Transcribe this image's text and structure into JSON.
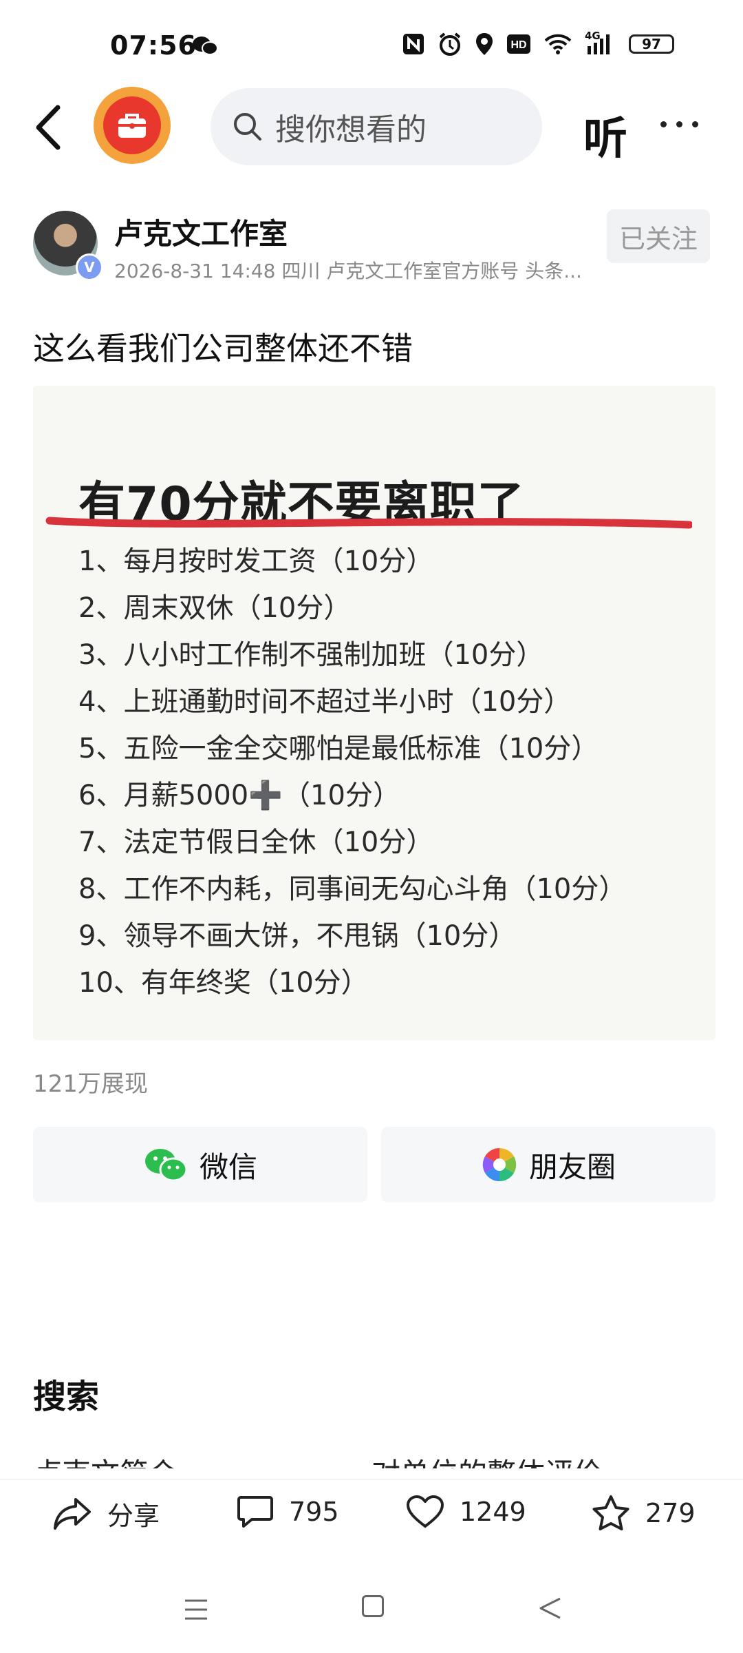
{
  "status_bar": {
    "time": "07:56",
    "network": "4G",
    "battery": "97"
  },
  "top_nav": {
    "search_placeholder": "搜你想看的",
    "listen_label": "听"
  },
  "author": {
    "name": "卢克文工作室",
    "meta": "2026-8-31 14:48 四川 卢克文工作室官方账号 头条...",
    "verify_badge": "V",
    "follow_label": "已关注"
  },
  "post": {
    "text": "这么看我们公司整体还不错"
  },
  "image_card": {
    "title": "有70分就不要离职了",
    "items": [
      "1、每月按时发工资（10分）",
      "2、周末双休（10分）",
      "3、八小时工作制不强制加班（10分）",
      "4、上班通勤时间不超过半小时（10分）",
      "5、五险一金全交哪怕是最低标准（10分）",
      "6、月薪5000➕（10分）",
      "7、法定节假日全休（10分）",
      "8、工作不内耗，同事间无勾心斗角（10分）",
      "9、领导不画大饼，不甩锅（10分）",
      "10、有年终奖（10分）"
    ]
  },
  "views": "121万展现",
  "share": {
    "wechat_label": "微信",
    "moments_label": "朋友圈"
  },
  "section": {
    "title": "搜索",
    "left_partial": "卢克文简介",
    "right_partial": "对单位的整体评价"
  },
  "bottom_bar": {
    "share_label": "分享",
    "comments": "795",
    "likes": "1249",
    "favorites": "279"
  },
  "colors": {
    "underline": "#d8333a",
    "logo_outer": "#f4a23c",
    "logo_inner": "#e8372d",
    "wechat_green": "#2bbd4e"
  }
}
